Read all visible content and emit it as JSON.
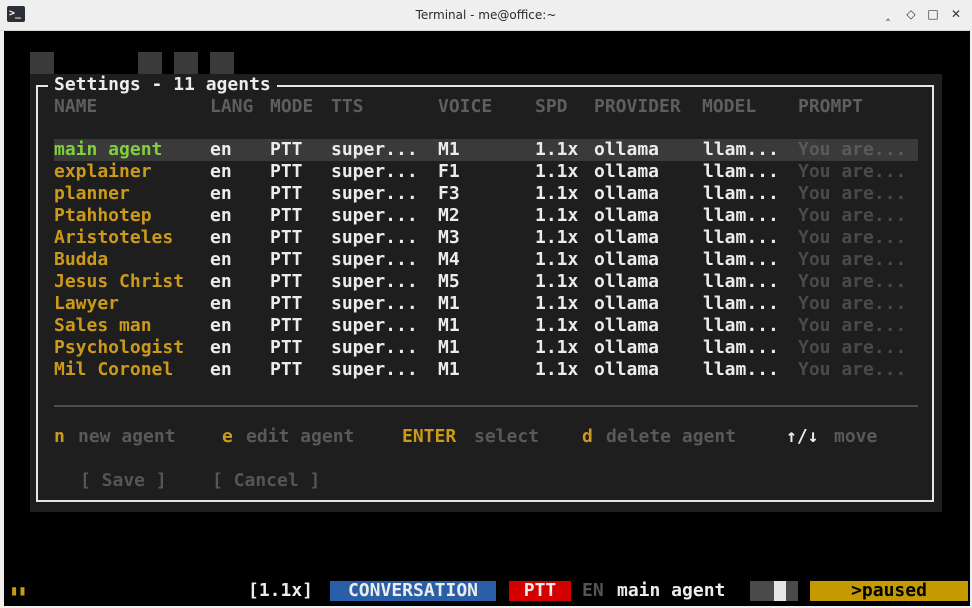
{
  "window": {
    "title": "Terminal - me@office:~",
    "app_icon": ">_",
    "minimize_icon": "‸",
    "maximize_icon": "◇",
    "restore_icon": "□",
    "close_icon": "✕"
  },
  "dialog": {
    "title": "Settings - 11 agents",
    "columns": [
      "NAME",
      "LANG",
      "MODE",
      "TTS",
      "VOICE",
      "SPD",
      "PROVIDER",
      "MODEL",
      "PROMPT"
    ],
    "selected_index": 0,
    "agents": [
      {
        "name": "main agent",
        "lang": "en",
        "mode": "PTT",
        "tts": "super...",
        "voice": "M1",
        "spd": "1.1x",
        "provider": "ollama",
        "model": "llam...",
        "prompt": "You are..."
      },
      {
        "name": "explainer",
        "lang": "en",
        "mode": "PTT",
        "tts": "super...",
        "voice": "F1",
        "spd": "1.1x",
        "provider": "ollama",
        "model": "llam...",
        "prompt": "You are..."
      },
      {
        "name": "planner",
        "lang": "en",
        "mode": "PTT",
        "tts": "super...",
        "voice": "F3",
        "spd": "1.1x",
        "provider": "ollama",
        "model": "llam...",
        "prompt": "You are..."
      },
      {
        "name": "Ptahhotep",
        "lang": "en",
        "mode": "PTT",
        "tts": "super...",
        "voice": "M2",
        "spd": "1.1x",
        "provider": "ollama",
        "model": "llam...",
        "prompt": "You are..."
      },
      {
        "name": "Aristoteles",
        "lang": "en",
        "mode": "PTT",
        "tts": "super...",
        "voice": "M3",
        "spd": "1.1x",
        "provider": "ollama",
        "model": "llam...",
        "prompt": "You are..."
      },
      {
        "name": "Budda",
        "lang": "en",
        "mode": "PTT",
        "tts": "super...",
        "voice": "M4",
        "spd": "1.1x",
        "provider": "ollama",
        "model": "llam...",
        "prompt": "You are..."
      },
      {
        "name": "Jesus Christ",
        "lang": "en",
        "mode": "PTT",
        "tts": "super...",
        "voice": "M5",
        "spd": "1.1x",
        "provider": "ollama",
        "model": "llam...",
        "prompt": "You are..."
      },
      {
        "name": "Lawyer",
        "lang": "en",
        "mode": "PTT",
        "tts": "super...",
        "voice": "M1",
        "spd": "1.1x",
        "provider": "ollama",
        "model": "llam...",
        "prompt": "You are..."
      },
      {
        "name": "Sales man",
        "lang": "en",
        "mode": "PTT",
        "tts": "super...",
        "voice": "M1",
        "spd": "1.1x",
        "provider": "ollama",
        "model": "llam...",
        "prompt": "You are..."
      },
      {
        "name": "Psychologist",
        "lang": "en",
        "mode": "PTT",
        "tts": "super...",
        "voice": "M1",
        "spd": "1.1x",
        "provider": "ollama",
        "model": "llam...",
        "prompt": "You are..."
      },
      {
        "name": "Mil Coronel",
        "lang": "en",
        "mode": "PTT",
        "tts": "super...",
        "voice": "M1",
        "spd": "1.1x",
        "provider": "ollama",
        "model": "llam...",
        "prompt": "You are..."
      }
    ],
    "shortcuts": [
      {
        "key": "n",
        "label": "new agent"
      },
      {
        "key": "e",
        "label": "edit agent"
      },
      {
        "key": "ENTER",
        "label": "select"
      },
      {
        "key": "d",
        "label": "delete agent"
      },
      {
        "key": "↑/↓",
        "label": "move"
      }
    ],
    "save_label": "[ Save ]",
    "cancel_label": "[ Cancel ]"
  },
  "statusbar": {
    "indicator": "▮▮",
    "speed": "[1.1x]",
    "mode": "CONVERSATION",
    "ptt": "PTT",
    "lang": "EN",
    "agent": "main agent",
    "state": ">paused",
    "colors": {
      "conversation_bg": "#2a5fa8",
      "ptt_bg": "#d40000",
      "paused_bg": "#c49a00",
      "indicator": "#c89a10"
    }
  }
}
